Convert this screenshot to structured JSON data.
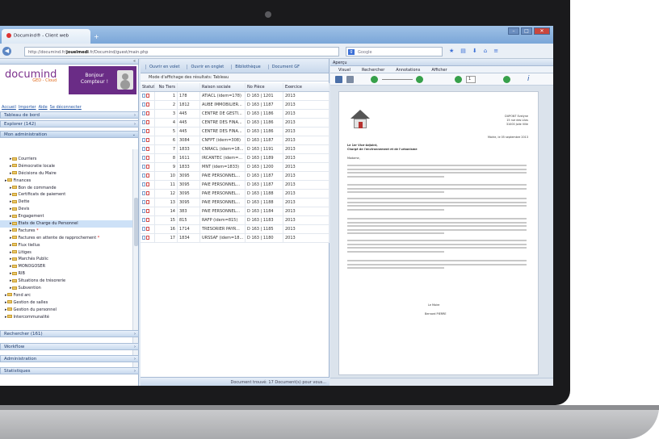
{
  "browser": {
    "tab_title": "Documind® - Client web",
    "url_prefix": "http://documind.fr/",
    "url_domain": "jouelmedi",
    "url_suffix": ".fr/Documind/guest/main.php",
    "search_placeholder": "Google"
  },
  "app": {
    "logo": "documind",
    "logo_sub": "GED - Cloud",
    "welcome": "Bonjour Compteur !",
    "top_links": [
      "Accueil",
      "Importer",
      "Aide",
      "Se déconnecter"
    ],
    "sections": [
      "Tableau de bord",
      "Explorer (142)",
      "Mon administration"
    ],
    "bottom_sections": [
      "Rechercher (161)",
      "Workflow",
      "Administration",
      "Statistiques"
    ],
    "tree": [
      {
        "label": "Courriers",
        "indent": 2
      },
      {
        "label": "Démocratie locale",
        "indent": 2
      },
      {
        "label": "Décisions du Maire",
        "indent": 2
      },
      {
        "label": "Finances",
        "indent": 1
      },
      {
        "label": "Bon de commande",
        "indent": 2
      },
      {
        "label": "Certificats de paiement",
        "indent": 2
      },
      {
        "label": "Dette",
        "indent": 2
      },
      {
        "label": "Devis",
        "indent": 2
      },
      {
        "label": "Engagement",
        "indent": 2
      },
      {
        "label": "Etats de Charge du Personnel",
        "indent": 2,
        "selected": true
      },
      {
        "label": "Factures",
        "indent": 2,
        "star": true
      },
      {
        "label": "Factures en attente de rapprochement",
        "indent": 2,
        "star": true
      },
      {
        "label": "Flux tiellus",
        "indent": 2
      },
      {
        "label": "Litiges",
        "indent": 2
      },
      {
        "label": "Marchés Public",
        "indent": 2
      },
      {
        "label": "MONOGOSER",
        "indent": 2
      },
      {
        "label": "RIB",
        "indent": 2
      },
      {
        "label": "Situations de trésorerie",
        "indent": 2
      },
      {
        "label": "Subvention",
        "indent": 2
      },
      {
        "label": "Fond arc",
        "indent": 1
      },
      {
        "label": "Gestion de salles",
        "indent": 1
      },
      {
        "label": "Gestion du personnel",
        "indent": 1
      },
      {
        "label": "Intercommunalité",
        "indent": 1
      }
    ]
  },
  "middle": {
    "buttons": [
      "Ouvrir en volet",
      "Ouvrir en onglet",
      "Bibliothèque",
      "Document GF"
    ],
    "mode": "Mode d'affichage des résultats: Tableau",
    "columns": [
      "Statut",
      "No Tiers",
      "Raison sociale",
      "No Pièce",
      "Exercice"
    ],
    "rows": [
      [
        "1",
        "178",
        "ATIACL (idem=178)",
        "D 163 | 1201",
        "2013"
      ],
      [
        "2",
        "1812",
        "AUBE IMMOBILIER...",
        "D 163 | 1187",
        "2013"
      ],
      [
        "3",
        "445",
        "CENTRE DE GESTI...",
        "D 163 | 1186",
        "2013"
      ],
      [
        "4",
        "445",
        "CENTRE DES FINA...",
        "D 163 | 1186",
        "2013"
      ],
      [
        "5",
        "445",
        "CENTRE DES FINA...",
        "D 163 | 1186",
        "2013"
      ],
      [
        "6",
        "3084",
        "CNFPT (idem=308)",
        "D 163 | 1187",
        "2013"
      ],
      [
        "7",
        "1833",
        "CNRACL (idem=18...",
        "D 163 | 1191",
        "2013"
      ],
      [
        "8",
        "1611",
        "IRCANTEC (idem=...",
        "D 163 | 1189",
        "2013"
      ],
      [
        "9",
        "1833",
        "MNT (idem=1833)",
        "D 163 | 1200",
        "2013"
      ],
      [
        "10",
        "3095",
        "PAIE PERSONNEL...",
        "D 163 | 1187",
        "2013"
      ],
      [
        "11",
        "3095",
        "PAIE PERSONNEL...",
        "D 163 | 1187",
        "2013"
      ],
      [
        "12",
        "3095",
        "PAIE PERSONNEL...",
        "D 163 | 1188",
        "2013"
      ],
      [
        "13",
        "3095",
        "PAIE PERSONNEL...",
        "D 163 | 1188",
        "2013"
      ],
      [
        "14",
        "383",
        "PAIE PERSONNEL...",
        "D 163 | 1184",
        "2013"
      ],
      [
        "15",
        "815",
        "RAFP (idem=815)",
        "D 163 | 1183",
        "2013"
      ],
      [
        "16",
        "1714",
        "TRESORIER PAYR...",
        "D 163 | 1185",
        "2013"
      ],
      [
        "17",
        "1834",
        "URSSAF (idem=18...",
        "D 163 | 1180",
        "2013"
      ]
    ],
    "status": "Document trouvé: 17 Document(s) pour vous..."
  },
  "right": {
    "tab_label": "Aperçu",
    "tabs": [
      "Visuel",
      "Rechercher",
      "Annotations",
      "Afficher"
    ],
    "page_input": "1",
    "doc": {
      "sender": [
        "DUPONT Evelyne",
        "15 rue des Lilas",
        "31000 Jolie Ville"
      ],
      "date": "Mairie, le 05 septembre 2013",
      "to": "Le 1er Vice-Adjoint,",
      "subject": "Chargé de l'environnement et de l'urbanisme",
      "salutation": "Madame,",
      "sign": [
        "Le Maire",
        "Bernard PIERRE"
      ]
    }
  }
}
